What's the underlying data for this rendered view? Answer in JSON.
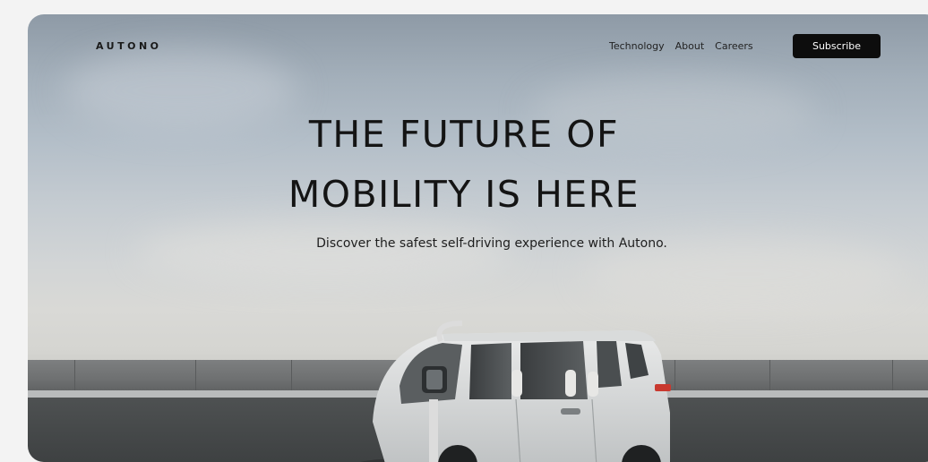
{
  "brand": {
    "logo_text": "AUTONO"
  },
  "nav": {
    "links": [
      {
        "label": "Technology"
      },
      {
        "label": "About"
      },
      {
        "label": "Careers"
      }
    ],
    "subscribe_label": "Subscribe"
  },
  "hero": {
    "headline_line1": "THE FUTURE OF",
    "headline_line2": "MOBILITY IS HERE",
    "subtext": "Discover the safest self-driving experience with Autono."
  },
  "colors": {
    "button_bg": "#0d0d0d",
    "button_text": "#ffffff",
    "headline_text": "#141414"
  }
}
